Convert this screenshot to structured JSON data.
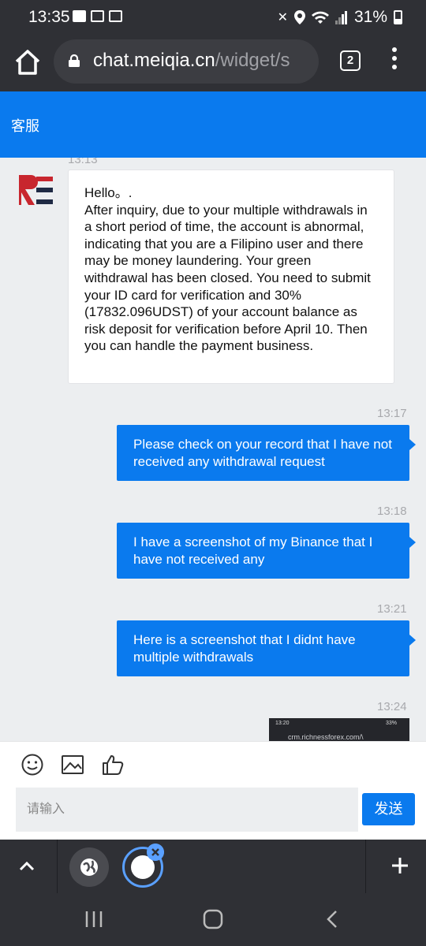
{
  "status_bar": {
    "time": "13:35",
    "battery": "31%"
  },
  "browser": {
    "url_main": "chat.meiqia.cn",
    "url_path": "/widget/s",
    "tab_count": "2"
  },
  "chat_header": {
    "title": "客服"
  },
  "messages": [
    {
      "time": "13:13",
      "direction": "incoming",
      "lines": [
        "Hello。.",
        "After inquiry, due to your multiple withdrawals in a short period of time, the account is abnormal, indicating that you are a Filipino user and there may be money laundering. Your green withdrawal has been closed. You need to submit your ID card for verification and 30% (17832.096UDST) of your account balance as risk deposit for verification before April 10. Then you can handle the payment business."
      ]
    },
    {
      "time": "13:17",
      "direction": "outgoing",
      "text": "Please check on your record that I have not received any withdrawal request"
    },
    {
      "time": "13:18",
      "direction": "outgoing",
      "text": "I have a screenshot of my Binance that I have not received any"
    },
    {
      "time": "13:21",
      "direction": "outgoing",
      "text": "Here is a screenshot that I didnt have multiple withdrawals"
    },
    {
      "time": "13:24",
      "direction": "outgoing",
      "image_status": "13:20",
      "image_battery": "33%",
      "image_url": "crm.richnessforex.com/\\"
    }
  ],
  "composer": {
    "placeholder": "请输入",
    "send_label": "发送"
  },
  "icons": {
    "emoji": "smiley-icon",
    "image": "image-icon",
    "like": "thumbs-up-icon"
  },
  "colors": {
    "accent": "#0a7aee",
    "chrome": "#2f3035",
    "chat_bg": "#eceef0"
  }
}
